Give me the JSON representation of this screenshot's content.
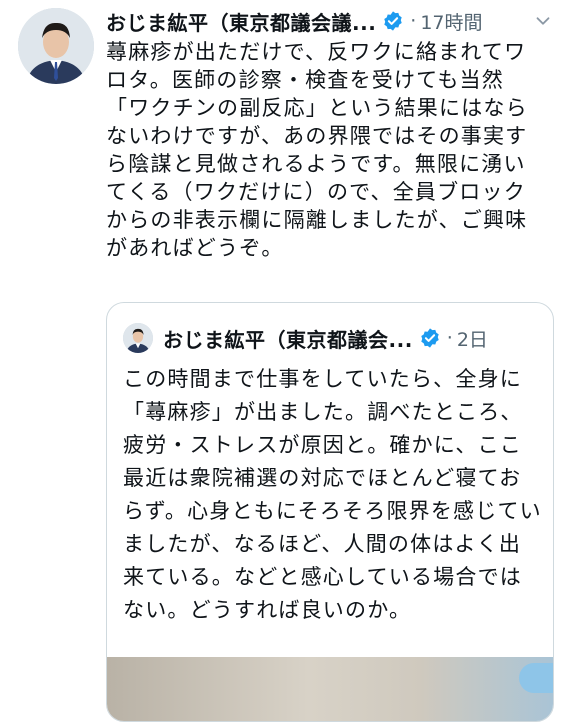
{
  "tweet": {
    "author_name": "おじま紘平（東京都議会議...",
    "separator": "·",
    "time": "17時間",
    "text": "蕁麻疹が出ただけで、反ワクに絡まれてワロタ。医師の診察・検査を受けても当然「ワクチンの副反応」という結果にはならないわけですが、あの界隈ではその事実すら陰謀と見做されるようです。無限に湧いてくる（ワクだけに）ので、全員ブロックからの非表示欄に隔離しましたが、ご興味があればどうぞ。"
  },
  "quoted_tweet": {
    "author_name": "おじま紘平（東京都議会...",
    "separator": "·",
    "time": "2日",
    "text": "この時間まで仕事をしていたら、全身に「蕁麻疹」が出ました。調べたところ、疲労・ストレスが原因と。確かに、ここ最近は衆院補選の対応でほとんど寝ておらず。心身ともにそろそろ限界を感じていましたが、なるほど、人間の体はよく出来ている。などと感心している場合ではない。どうすれば良いのか。"
  },
  "icons": {
    "verified": "verified-badge-icon",
    "more": "more-options-icon"
  },
  "colors": {
    "text": "#0f1419",
    "muted": "#536471",
    "verified": "#1d9bf0",
    "border": "#cfd9de"
  }
}
